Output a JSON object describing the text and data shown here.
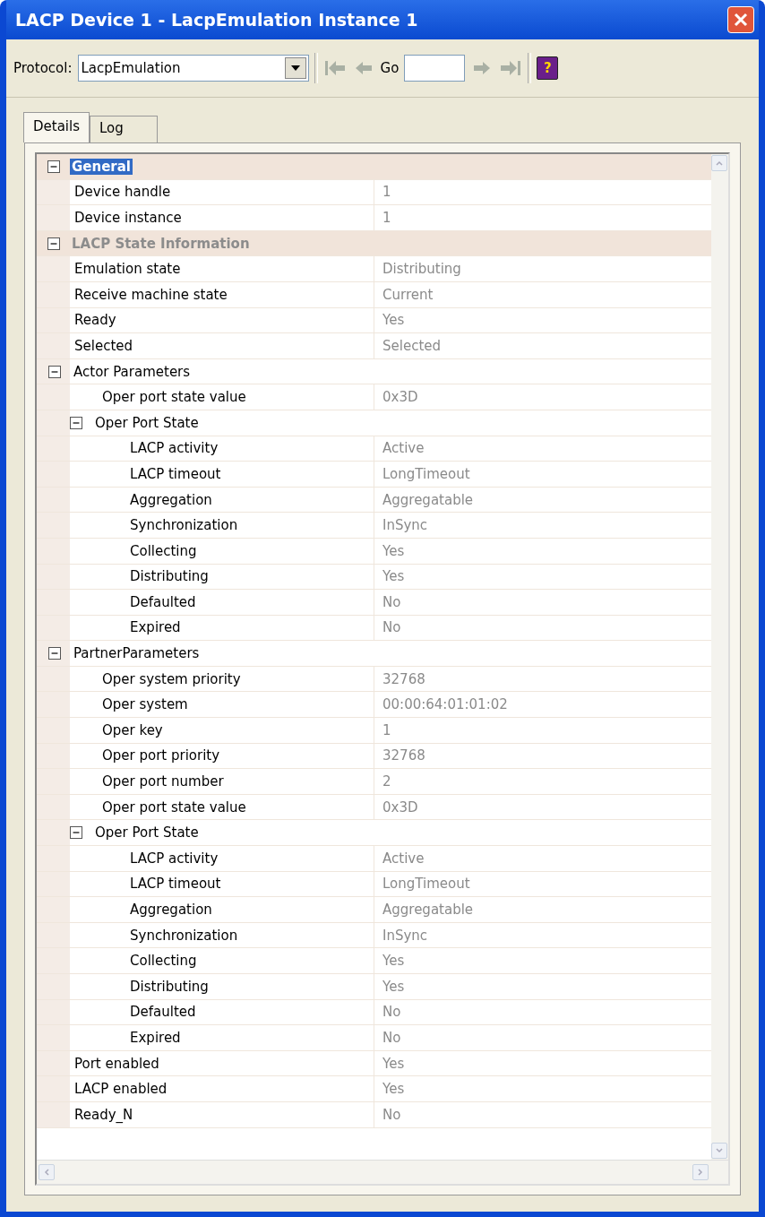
{
  "window": {
    "title": "LACP Device 1 - LacpEmulation Instance 1"
  },
  "toolbar": {
    "protocol_label": "Protocol:",
    "protocol_value": "LacpEmulation",
    "go_label": "Go",
    "help_label": "?"
  },
  "tabs": [
    {
      "label": "Details",
      "selected": true
    },
    {
      "label": "Log",
      "selected": false
    }
  ],
  "grid": [
    {
      "kind": "category",
      "name": "General",
      "expanded": true,
      "selected": true,
      "children": [
        {
          "kind": "property",
          "name": "Device handle",
          "value": "1"
        },
        {
          "kind": "property",
          "name": "Device instance",
          "value": "1"
        }
      ]
    },
    {
      "kind": "category",
      "name": "LACP State Information",
      "expanded": true,
      "selected": false,
      "children": [
        {
          "kind": "property",
          "name": "Emulation state",
          "value": "Distributing"
        },
        {
          "kind": "property",
          "name": "Receive machine state",
          "value": "Current"
        },
        {
          "kind": "property",
          "name": "Ready",
          "value": "Yes"
        },
        {
          "kind": "property",
          "name": "Selected",
          "value": "Selected"
        },
        {
          "kind": "group",
          "name": "Actor Parameters",
          "expanded": true,
          "children": [
            {
              "kind": "property",
              "name": "Oper port state value",
              "value": "0x3D"
            },
            {
              "kind": "group",
              "name": "Oper Port State",
              "expanded": true,
              "children": [
                {
                  "kind": "property",
                  "name": "LACP activity",
                  "value": "Active"
                },
                {
                  "kind": "property",
                  "name": "LACP timeout",
                  "value": "LongTimeout"
                },
                {
                  "kind": "property",
                  "name": "Aggregation",
                  "value": "Aggregatable"
                },
                {
                  "kind": "property",
                  "name": "Synchronization",
                  "value": "InSync"
                },
                {
                  "kind": "property",
                  "name": "Collecting",
                  "value": "Yes"
                },
                {
                  "kind": "property",
                  "name": "Distributing",
                  "value": "Yes"
                },
                {
                  "kind": "property",
                  "name": "Defaulted",
                  "value": "No"
                },
                {
                  "kind": "property",
                  "name": "Expired",
                  "value": "No"
                }
              ]
            }
          ]
        },
        {
          "kind": "group",
          "name": "PartnerParameters",
          "expanded": true,
          "children": [
            {
              "kind": "property",
              "name": "Oper system priority",
              "value": "32768"
            },
            {
              "kind": "property",
              "name": "Oper system",
              "value": "00:00:64:01:01:02"
            },
            {
              "kind": "property",
              "name": "Oper key",
              "value": "1"
            },
            {
              "kind": "property",
              "name": "Oper port priority",
              "value": "32768"
            },
            {
              "kind": "property",
              "name": "Oper port number",
              "value": "2"
            },
            {
              "kind": "property",
              "name": "Oper port state value",
              "value": "0x3D"
            },
            {
              "kind": "group",
              "name": "Oper Port State",
              "expanded": true,
              "children": [
                {
                  "kind": "property",
                  "name": "LACP activity",
                  "value": "Active"
                },
                {
                  "kind": "property",
                  "name": "LACP timeout",
                  "value": "LongTimeout"
                },
                {
                  "kind": "property",
                  "name": "Aggregation",
                  "value": "Aggregatable"
                },
                {
                  "kind": "property",
                  "name": "Synchronization",
                  "value": "InSync"
                },
                {
                  "kind": "property",
                  "name": "Collecting",
                  "value": "Yes"
                },
                {
                  "kind": "property",
                  "name": "Distributing",
                  "value": "Yes"
                },
                {
                  "kind": "property",
                  "name": "Defaulted",
                  "value": "No"
                },
                {
                  "kind": "property",
                  "name": "Expired",
                  "value": "No"
                }
              ]
            }
          ]
        },
        {
          "kind": "property",
          "name": "Port enabled",
          "value": "Yes"
        },
        {
          "kind": "property",
          "name": "LACP enabled",
          "value": "Yes"
        },
        {
          "kind": "property",
          "name": "Ready_N",
          "value": "No"
        }
      ]
    }
  ]
}
